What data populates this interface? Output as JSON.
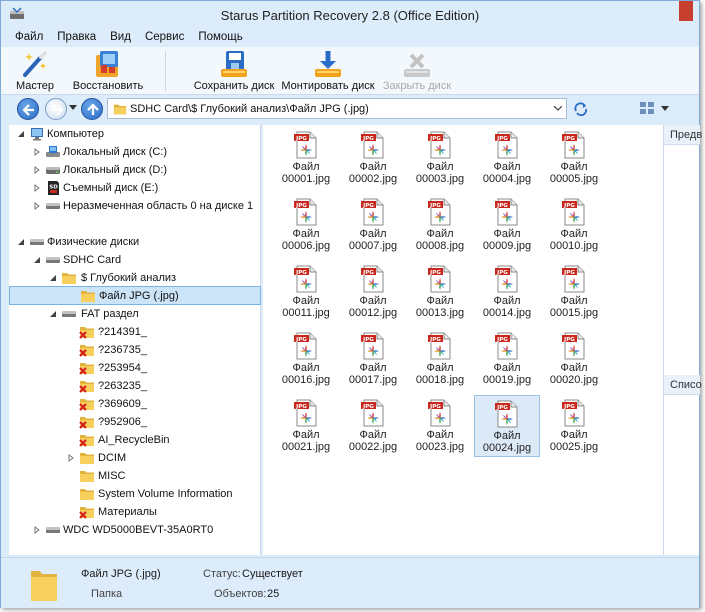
{
  "window": {
    "title": "Starus Partition Recovery 2.8 (Office Edition)"
  },
  "menu": [
    "Файл",
    "Правка",
    "Вид",
    "Сервис",
    "Помощь"
  ],
  "toolbar": {
    "wizard": "Мастер",
    "restore": "Восстановить",
    "save_disk": "Сохранить диск",
    "mount_disk": "Монтировать диск",
    "close_disk": "Закрыть диск"
  },
  "address": {
    "path": "SDHC Card\\$ Глубокий анализ\\Файл JPG (.jpg)"
  },
  "tree": {
    "computer": "Компьютер",
    "drive_c": "Локальный диск (C:)",
    "drive_d": "Локальный диск (D:)",
    "drive_e": "Съемный диск (E:)",
    "unallocated": "Неразмеченная область 0 на диске 1",
    "physical": "Физические диски",
    "sdhc": "SDHC Card",
    "deep": "$ Глубокий анализ",
    "jpg": "Файл JPG (.jpg)",
    "fat": "FAT раздел",
    "fat_items": [
      "?214391_",
      "?236735_",
      "?253954_",
      "?263235_",
      "?369609_",
      "?952906_",
      "AI_RecycleBin"
    ],
    "dcim": "DCIM",
    "misc": "MISC",
    "svi": "System Volume Information",
    "materials": "Материалы",
    "wdc": "WDC WD5000BEVT-35A0RT0"
  },
  "files": {
    "line1": "Файл",
    "names": [
      "00001.jpg",
      "00002.jpg",
      "00003.jpg",
      "00004.jpg",
      "00005.jpg",
      "00006.jpg",
      "00007.jpg",
      "00008.jpg",
      "00009.jpg",
      "00010.jpg",
      "00011.jpg",
      "00012.jpg",
      "00013.jpg",
      "00014.jpg",
      "00015.jpg",
      "00016.jpg",
      "00017.jpg",
      "00018.jpg",
      "00019.jpg",
      "00020.jpg",
      "00021.jpg",
      "00022.jpg",
      "00023.jpg",
      "00024.jpg",
      "00025.jpg"
    ],
    "selected_index": 23,
    "badge": "JPG"
  },
  "preview": {
    "header": "Предв",
    "list_header": "Списо"
  },
  "status": {
    "name": "Файл JPG (.jpg)",
    "type": "Папка",
    "status_label": "Статус:",
    "status_value": "Существует",
    "objects_label": "Объектов:",
    "objects_value": "25"
  },
  "colors": {
    "accent": "#2a6cc4",
    "jpg_red": "#c8281e",
    "folder": "#f4c74f",
    "selection": "#cce4f7"
  }
}
